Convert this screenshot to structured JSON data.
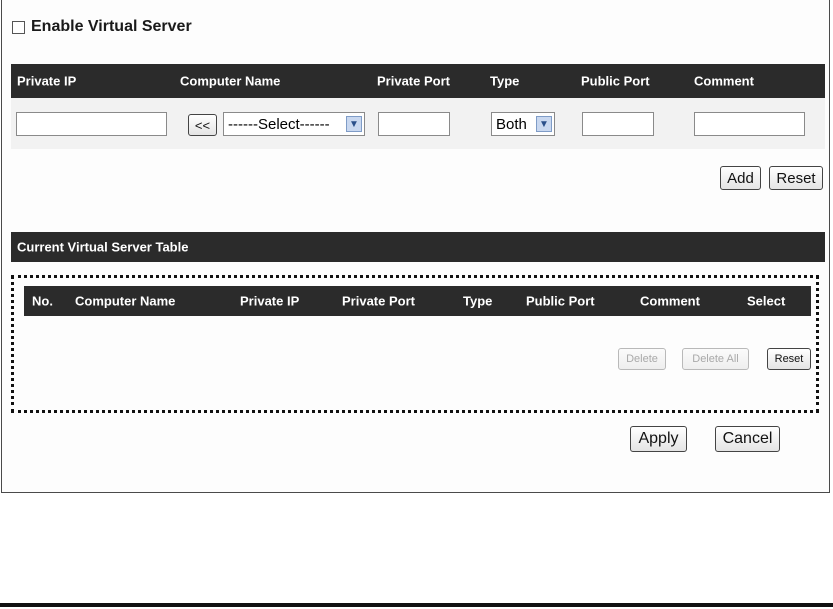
{
  "enable": {
    "label": "Enable Virtual Server"
  },
  "entry_table": {
    "headers": [
      "Private IP",
      "Computer Name",
      "Private Port",
      "Type",
      "Public Port",
      "Comment"
    ],
    "copy_button": "<<",
    "computer_select": "------Select------",
    "type_select": "Both",
    "add_label": "Add",
    "reset_label": "Reset"
  },
  "current_table": {
    "title": "Current Virtual Server Table",
    "headers": [
      "No.",
      "Computer Name",
      "Private IP",
      "Private Port",
      "Type",
      "Public Port",
      "Comment",
      "Select"
    ],
    "delete_label": "Delete",
    "delete_all_label": "Delete All",
    "reset_label": "Reset"
  },
  "footer": {
    "apply_label": "Apply",
    "cancel_label": "Cancel"
  },
  "icons": {
    "dropdown_arrow": "chevron-down-icon",
    "checkbox": "checkbox-icon"
  },
  "colors": {
    "header_bar": "#2b2b2b",
    "entry_bg": "#f2f2f2"
  }
}
